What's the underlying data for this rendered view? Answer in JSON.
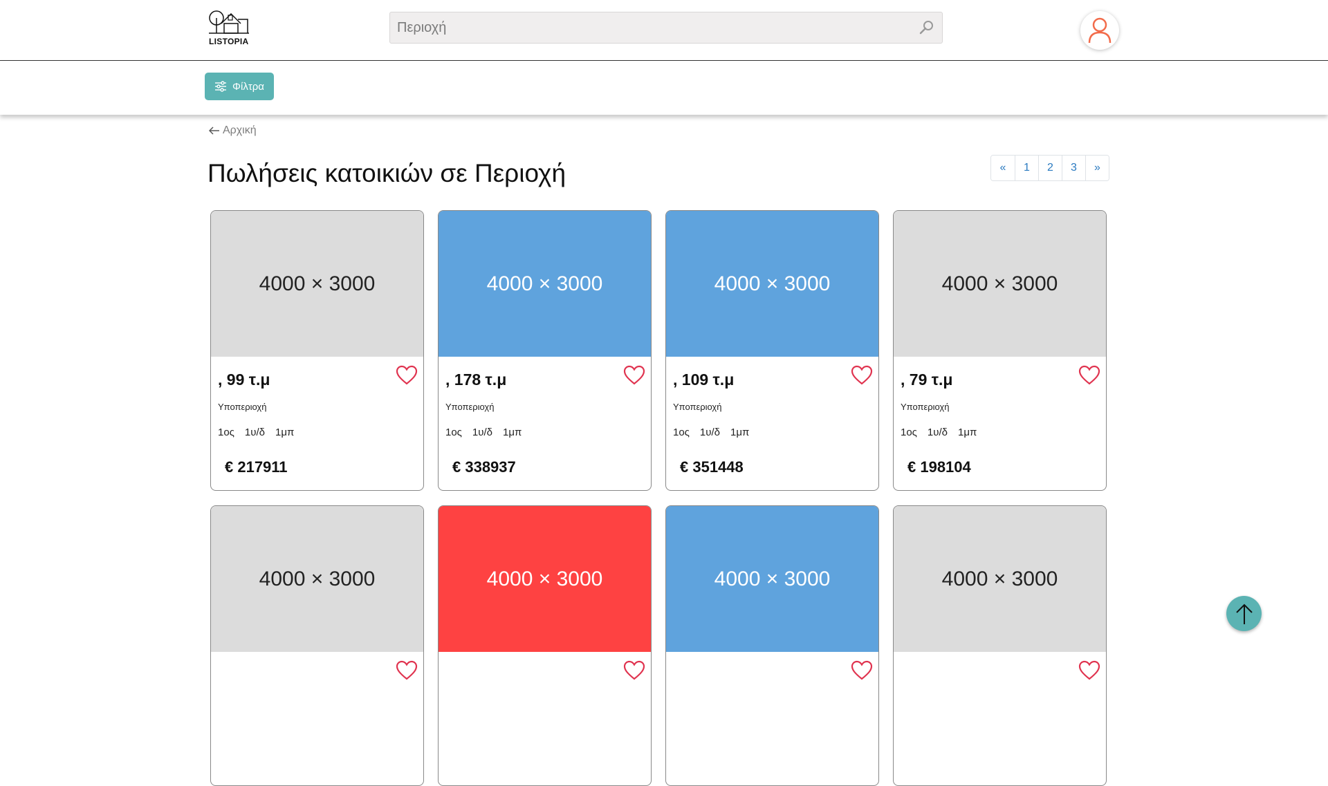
{
  "header": {
    "logo_text": "LISTOPIA",
    "search_placeholder": "Περιοχή"
  },
  "filters": {
    "button_label": "Φίλτρα"
  },
  "breadcrumb": {
    "back_label": "Αρχική"
  },
  "page_title": "Πωλήσεις κατοικιών σε Περιοχή",
  "pagination": {
    "prev": "«",
    "pages": [
      "1",
      "2",
      "3"
    ],
    "next": "»"
  },
  "listings": [
    {
      "image_label": "4000 × 3000",
      "image_color": "gray",
      "area": ", 99 τ.μ",
      "subarea": "Υποπεριοχή",
      "floor": "1ος",
      "bedrooms": "1υ/δ",
      "bathrooms": "1μπ",
      "price": "€ 217911"
    },
    {
      "image_label": "4000 × 3000",
      "image_color": "blue",
      "area": ", 178 τ.μ",
      "subarea": "Υποπεριοχή",
      "floor": "1ος",
      "bedrooms": "1υ/δ",
      "bathrooms": "1μπ",
      "price": "€ 338937"
    },
    {
      "image_label": "4000 × 3000",
      "image_color": "blue",
      "area": ", 109 τ.μ",
      "subarea": "Υποπεριοχή",
      "floor": "1ος",
      "bedrooms": "1υ/δ",
      "bathrooms": "1μπ",
      "price": "€ 351448"
    },
    {
      "image_label": "4000 × 3000",
      "image_color": "gray",
      "area": ", 79 τ.μ",
      "subarea": "Υποπεριοχή",
      "floor": "1ος",
      "bedrooms": "1υ/δ",
      "bathrooms": "1μπ",
      "price": "€ 198104"
    },
    {
      "image_label": "4000 × 3000",
      "image_color": "gray"
    },
    {
      "image_label": "4000 × 3000",
      "image_color": "red"
    },
    {
      "image_label": "4000 × 3000",
      "image_color": "blue"
    },
    {
      "image_label": "4000 × 3000",
      "image_color": "gray"
    }
  ],
  "colors": {
    "accent": "#5bb3b3",
    "heart": "#e0334f",
    "user_icon": "#f26b4a",
    "link": "#2a7ac0"
  },
  "icons": {
    "search": "search-icon",
    "user": "user-icon",
    "filter": "sliders-icon",
    "back": "arrow-left-icon",
    "favorite": "heart-icon",
    "scroll_top": "arrow-up-icon"
  }
}
